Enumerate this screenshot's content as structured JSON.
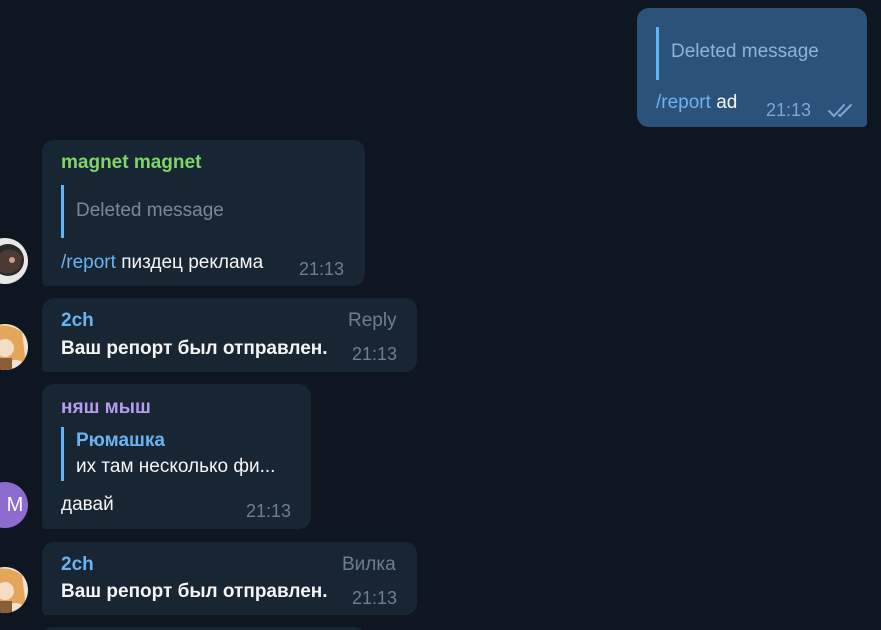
{
  "colors": {
    "background": "#0e1621",
    "incoming_bubble": "#182533",
    "outgoing_bubble": "#2b5278",
    "link": "#6ab3f3",
    "sender_green": "#7fd46a",
    "sender_blue": "#6ab3f3",
    "sender_purple": "#b49cf0",
    "muted": "#6d7f8f"
  },
  "messages": [
    {
      "direction": "outgoing",
      "reply_quote": "Deleted message",
      "command": "/report",
      "text": " ad",
      "time": "21:13",
      "status_icon": "double-check-icon"
    },
    {
      "direction": "incoming",
      "sender": "magnet magnet",
      "reply_quote": "Deleted message",
      "command": "/report",
      "text": " пиздец реклама",
      "time": "21:13",
      "avatar_icon": "user-photo-avatar"
    },
    {
      "direction": "incoming",
      "sender": "2ch",
      "label": "Reply",
      "text": "Ваш репорт был отправлен.",
      "time": "21:13",
      "avatar_icon": "anime-avatar"
    },
    {
      "direction": "incoming",
      "sender": "няш мыш",
      "reply_author": "Рюмашка",
      "reply_quote": "их там несколько фи...",
      "text": "давай",
      "time": "21:13",
      "avatar_initial": "М"
    },
    {
      "direction": "incoming",
      "sender": "2ch",
      "label": "Вилка",
      "text": "Ваш репорт был отправлен.",
      "time": "21:13",
      "avatar_icon": "anime-avatar"
    }
  ]
}
